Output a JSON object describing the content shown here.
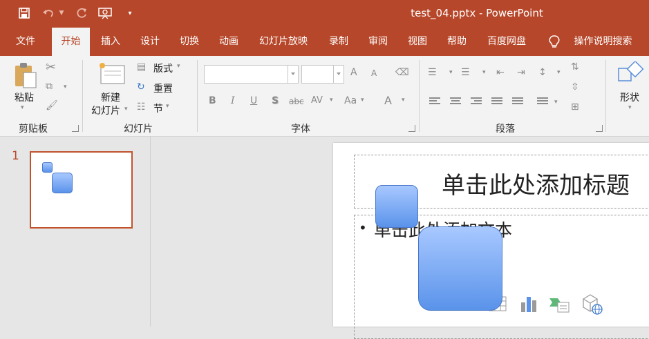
{
  "window": {
    "title": "test_04.pptx  -  PowerPoint"
  },
  "quick_access": {
    "icons": [
      "save-icon",
      "undo-icon",
      "redo-icon",
      "present-icon",
      "customize-icon"
    ]
  },
  "tabs": [
    {
      "label": "文件"
    },
    {
      "label": "开始",
      "active": true
    },
    {
      "label": "插入"
    },
    {
      "label": "设计"
    },
    {
      "label": "切换"
    },
    {
      "label": "动画"
    },
    {
      "label": "幻灯片放映"
    },
    {
      "label": "录制"
    },
    {
      "label": "审阅"
    },
    {
      "label": "视图"
    },
    {
      "label": "帮助"
    },
    {
      "label": "百度网盘"
    }
  ],
  "tell_me": {
    "label": "操作说明搜索"
  },
  "ribbon": {
    "clipboard": {
      "group_label": "剪贴板",
      "paste_label": "粘贴"
    },
    "slides": {
      "group_label": "幻灯片",
      "new_slide_label_1": "新建",
      "new_slide_label_2": "幻灯片",
      "layout_label": "版式",
      "reset_label": "重置",
      "section_label": "节"
    },
    "font": {
      "group_label": "字体",
      "font_name": "",
      "font_size": "",
      "bold": "B",
      "italic": "I",
      "underline": "U",
      "shadow": "S",
      "strike": "abc",
      "spacing": "AV",
      "case": "Aa",
      "color": "A",
      "grow": "A",
      "shrink": "A"
    },
    "paragraph": {
      "group_label": "段落"
    },
    "drawing": {
      "shape_label": "形状"
    }
  },
  "slides_pane": {
    "slide_number": "1"
  },
  "slide": {
    "title_placeholder": "单击此处添加标题",
    "body_placeholder": "单击此处添加文本",
    "bullet": "•"
  },
  "colors": {
    "accent": "#b7472a",
    "shape_fill_top": "#a8c8ff",
    "shape_fill_bottom": "#5a93ea"
  }
}
